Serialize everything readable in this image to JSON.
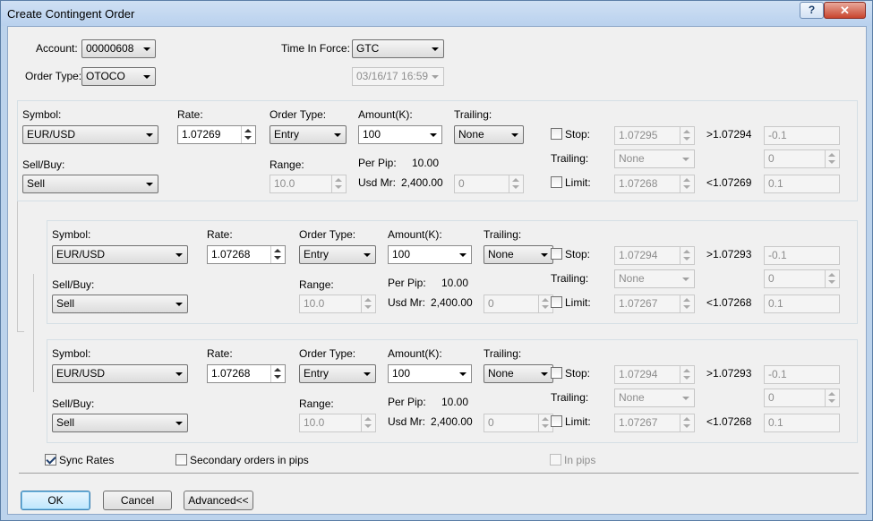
{
  "window": {
    "title": "Create Contingent Order",
    "help_glyph": "?",
    "close_glyph": "✕"
  },
  "header": {
    "account_label": "Account:",
    "account_value": "00000608",
    "order_type_label": "Order Type:",
    "order_type_value": "OTOCO",
    "tif_label": "Time In Force:",
    "tif_value": "GTC",
    "expiry_value": "03/16/17 16:59"
  },
  "labels": {
    "symbol": "Symbol:",
    "sellbuy": "Sell/Buy:",
    "rate": "Rate:",
    "order_type": "Order Type:",
    "range": "Range:",
    "amount": "Amount(K):",
    "per_pip": "Per Pip:",
    "usd_mr": "Usd Mr:",
    "trailing_col": "Trailing:",
    "stop": "Stop:",
    "trailing": "Trailing:",
    "limit": "Limit:"
  },
  "orders": [
    {
      "symbol": "EUR/USD",
      "side": "Sell",
      "rate": "1.07269",
      "order_type": "Entry",
      "range": "10.0",
      "amount": "100",
      "per_pip": "10.00",
      "usd_mr": "2,400.00",
      "mr_input": "0",
      "trailing_value": "None",
      "stop_rate": "1.07295",
      "stop_bound": ">1.07294",
      "stop_pips": "-0.1",
      "trailing_stop": "None",
      "trailing_stop_pips": "0",
      "limit_rate": "1.07268",
      "limit_bound": "<1.07269",
      "limit_pips": "0.1"
    },
    {
      "symbol": "EUR/USD",
      "side": "Sell",
      "rate": "1.07268",
      "order_type": "Entry",
      "range": "10.0",
      "amount": "100",
      "per_pip": "10.00",
      "usd_mr": "2,400.00",
      "mr_input": "0",
      "trailing_value": "None",
      "stop_rate": "1.07294",
      "stop_bound": ">1.07293",
      "stop_pips": "-0.1",
      "trailing_stop": "None",
      "trailing_stop_pips": "0",
      "limit_rate": "1.07267",
      "limit_bound": "<1.07268",
      "limit_pips": "0.1"
    },
    {
      "symbol": "EUR/USD",
      "side": "Sell",
      "rate": "1.07268",
      "order_type": "Entry",
      "range": "10.0",
      "amount": "100",
      "per_pip": "10.00",
      "usd_mr": "2,400.00",
      "mr_input": "0",
      "trailing_value": "None",
      "stop_rate": "1.07294",
      "stop_bound": ">1.07293",
      "stop_pips": "-0.1",
      "trailing_stop": "None",
      "trailing_stop_pips": "0",
      "limit_rate": "1.07267",
      "limit_bound": "<1.07268",
      "limit_pips": "0.1"
    }
  ],
  "footer": {
    "sync_rates": "Sync Rates",
    "secondary_pips": "Secondary orders in pips",
    "in_pips": "In pips",
    "ok": "OK",
    "cancel": "Cancel",
    "advanced": "Advanced<<"
  }
}
